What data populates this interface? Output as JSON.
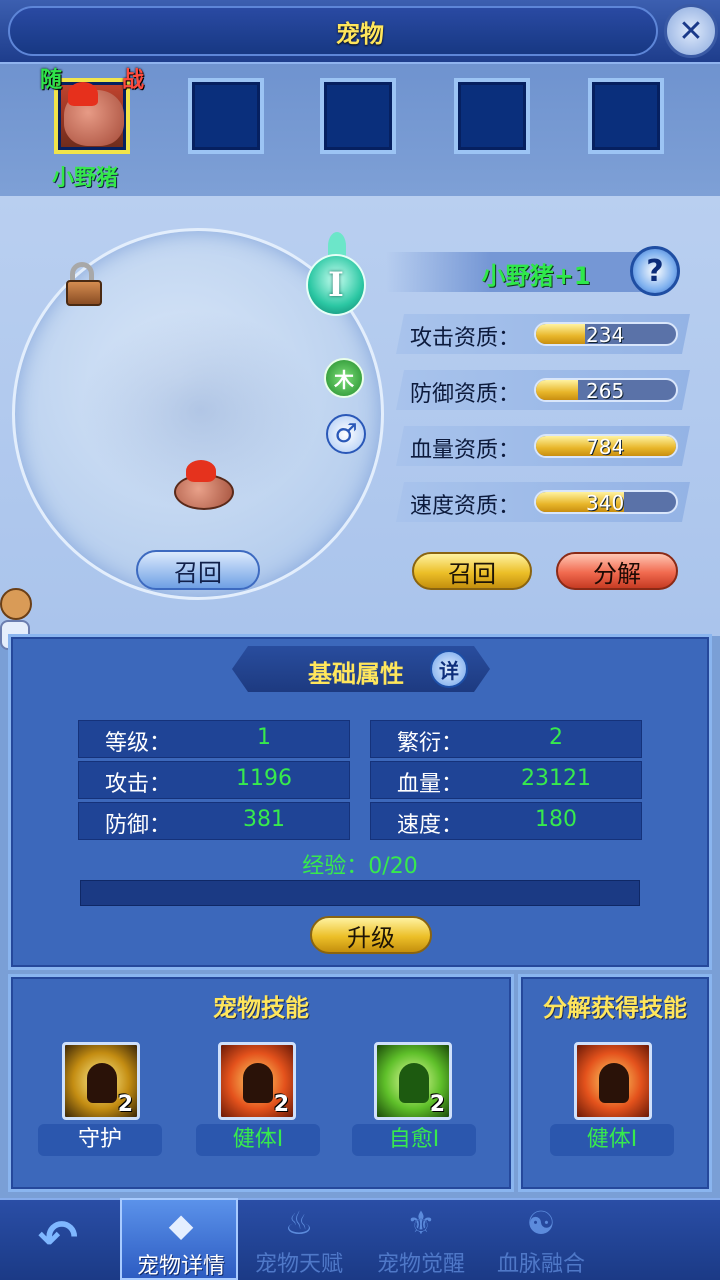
{
  "header": {
    "title": "宠物",
    "close_icon": "close-icon"
  },
  "slots": {
    "active": {
      "name": "小野猪",
      "tag_follow": "随",
      "tag_battle": "战"
    },
    "empty_count": 4
  },
  "pet": {
    "display_name": "小野猪+1",
    "grade": "I",
    "element": "木",
    "gender": "♂",
    "help": "?",
    "recall_left": "召回"
  },
  "qualities": [
    {
      "label": "攻击资质：",
      "value": "234",
      "fill": 0.35
    },
    {
      "label": "防御资质：",
      "value": "265",
      "fill": 0.3
    },
    {
      "label": "血量资质：",
      "value": "784",
      "fill": 1.0
    },
    {
      "label": "速度资质：",
      "value": "340",
      "fill": 0.63
    }
  ],
  "actions": {
    "recall": "召回",
    "decompose": "分解"
  },
  "basic": {
    "title": "基础属性",
    "detail": "详",
    "stats": [
      {
        "label": "等级：",
        "value": "1"
      },
      {
        "label": "繁衍：",
        "value": "2"
      },
      {
        "label": "攻击：",
        "value": "1196"
      },
      {
        "label": "血量：",
        "value": "23121"
      },
      {
        "label": "防御：",
        "value": "381"
      },
      {
        "label": "速度：",
        "value": "180"
      }
    ],
    "exp_text": "经验：0/20",
    "exp_fill": 0,
    "upgrade": "升级"
  },
  "skills": {
    "title": "宠物技能",
    "items": [
      {
        "name": "守护",
        "level": "2",
        "name_color": "#ffffff"
      },
      {
        "name": "健体Ⅰ",
        "level": "2",
        "name_color": "#37ea4d"
      },
      {
        "name": "自愈Ⅰ",
        "level": "2",
        "name_color": "#37ea4d"
      }
    ]
  },
  "decompose_skills": {
    "title": "分解获得技能",
    "items": [
      {
        "name": "健体Ⅰ",
        "name_color": "#37ea4d"
      }
    ]
  },
  "nav": {
    "tabs": [
      {
        "label": "宠物详情",
        "icon": "wolf-icon"
      },
      {
        "label": "宠物天赋",
        "icon": "flame-icon"
      },
      {
        "label": "宠物觉醒",
        "icon": "crest-icon"
      },
      {
        "label": "血脉融合",
        "icon": "swirl-icon"
      }
    ]
  }
}
